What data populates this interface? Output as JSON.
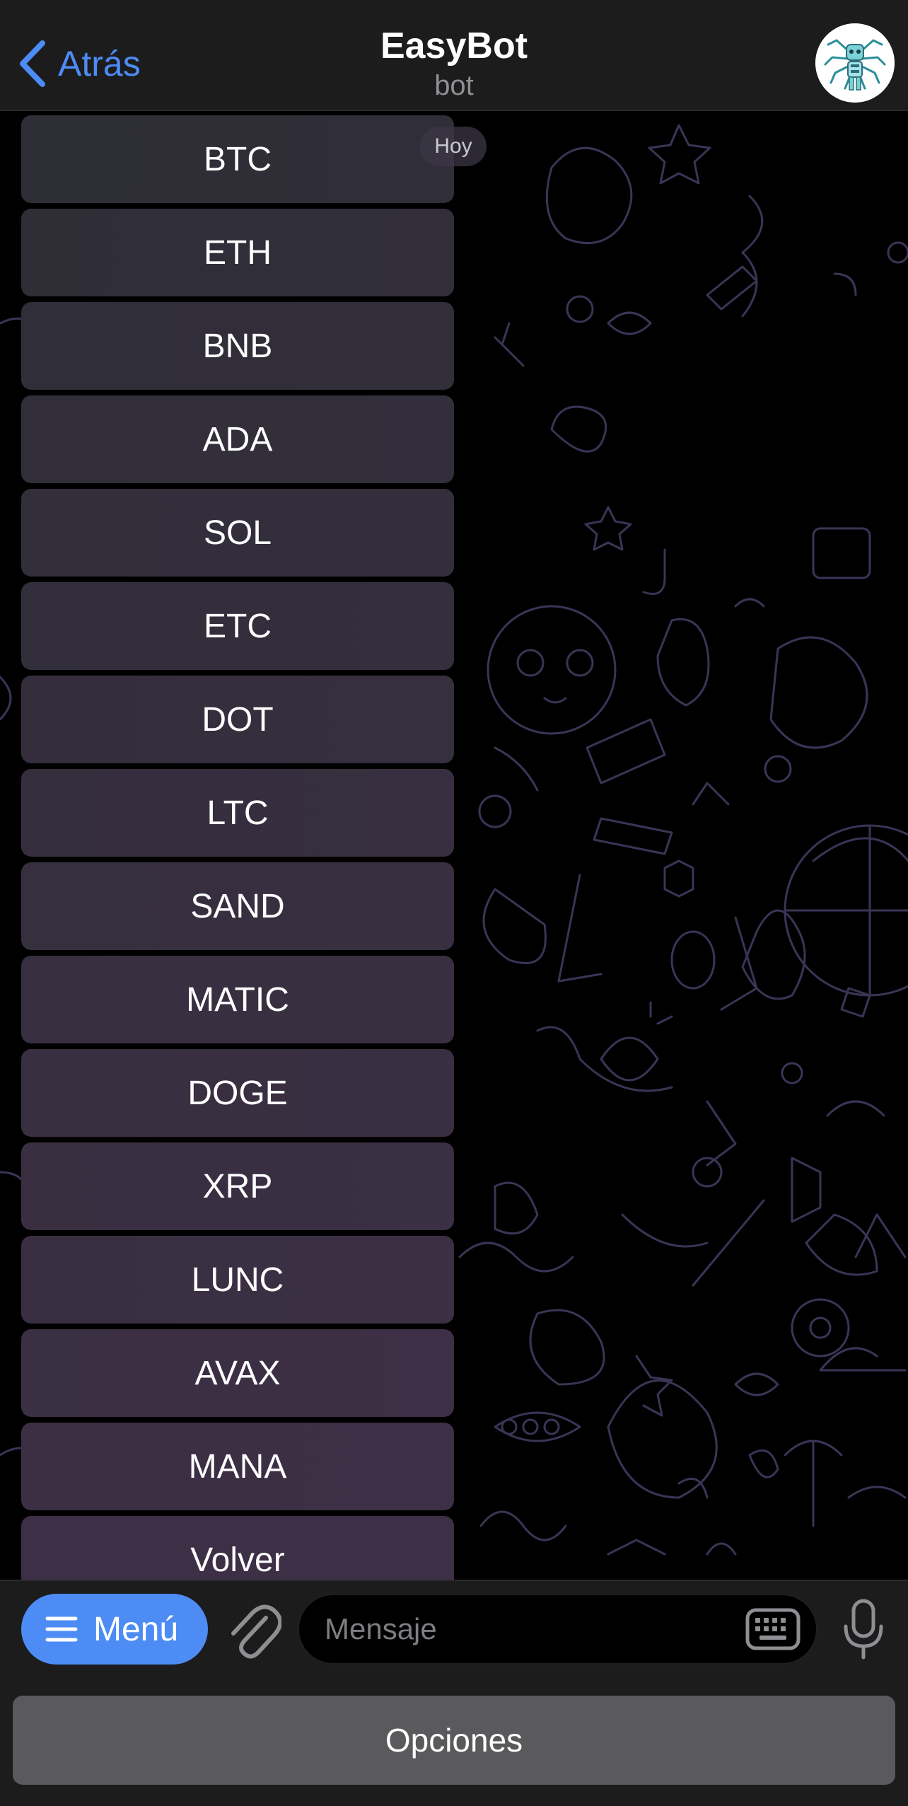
{
  "header": {
    "back_label": "Atrás",
    "title": "EasyBot",
    "subtitle": "bot",
    "avatar_icon": "robot-spider-avatar-icon"
  },
  "chat": {
    "date_label": "Hoy",
    "reply_keyboard": [
      "BTC",
      "ETH",
      "BNB",
      "ADA",
      "SOL",
      "ETC",
      "DOT",
      "LTC",
      "SAND",
      "MATIC",
      "DOGE",
      "XRP",
      "LUNC",
      "AVAX",
      "MANA",
      "Volver"
    ]
  },
  "input_bar": {
    "menu_label": "Menú",
    "message_placeholder": "Mensaje",
    "icons": [
      "hamburger-icon",
      "paperclip-icon",
      "keyboard-icon",
      "microphone-icon"
    ]
  },
  "bottom_keyboard": {
    "options_label": "Opciones"
  },
  "colors": {
    "accent": "#4d8cf5",
    "bar_background": "#1c1c1d",
    "button_top": "#2e2e36",
    "button_bottom": "#3d2f45",
    "options_button": "#5a5a5d"
  }
}
